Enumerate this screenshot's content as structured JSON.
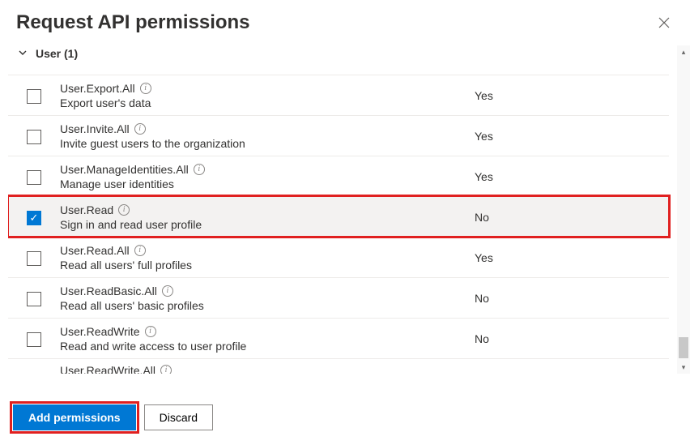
{
  "header": {
    "title": "Request API permissions"
  },
  "group": {
    "label": "User (1)"
  },
  "permissions": [
    {
      "name": "User.Export.All",
      "desc": "Export user's data",
      "admin": "Yes",
      "checked": false,
      "highlighted": false
    },
    {
      "name": "User.Invite.All",
      "desc": "Invite guest users to the organization",
      "admin": "Yes",
      "checked": false,
      "highlighted": false
    },
    {
      "name": "User.ManageIdentities.All",
      "desc": "Manage user identities",
      "admin": "Yes",
      "checked": false,
      "highlighted": false
    },
    {
      "name": "User.Read",
      "desc": "Sign in and read user profile",
      "admin": "No",
      "checked": true,
      "highlighted": true
    },
    {
      "name": "User.Read.All",
      "desc": "Read all users' full profiles",
      "admin": "Yes",
      "checked": false,
      "highlighted": false
    },
    {
      "name": "User.ReadBasic.All",
      "desc": "Read all users' basic profiles",
      "admin": "No",
      "checked": false,
      "highlighted": false
    },
    {
      "name": "User.ReadWrite",
      "desc": "Read and write access to user profile",
      "admin": "No",
      "checked": false,
      "highlighted": false
    },
    {
      "name": "User.ReadWrite.All",
      "desc": "",
      "admin": "",
      "checked": false,
      "highlighted": false
    }
  ],
  "footer": {
    "add_label": "Add permissions",
    "discard_label": "Discard"
  }
}
